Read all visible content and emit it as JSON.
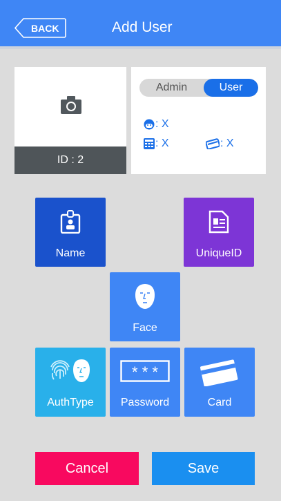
{
  "header": {
    "back_label": "BACK",
    "title": "Add User"
  },
  "profile": {
    "id_label": "ID : 2"
  },
  "role_toggle": {
    "options": [
      "Admin",
      "User"
    ],
    "selected": "User"
  },
  "stats": {
    "face": ": X",
    "password": ": X",
    "card": ": X"
  },
  "tiles": {
    "name": "Name",
    "unique_id": "UniqueID",
    "face": "Face",
    "auth_type": "AuthType",
    "password": "Password",
    "card": "Card"
  },
  "actions": {
    "cancel": "Cancel",
    "save": "Save"
  },
  "colors": {
    "header": "#3f86f5",
    "name_tile": "#1a52cc",
    "unique_tile": "#7d35d6",
    "face_tile": "#3f86f5",
    "auth_tile": "#29b0ea",
    "cancel": "#f8095f",
    "save": "#1a8ff0"
  }
}
